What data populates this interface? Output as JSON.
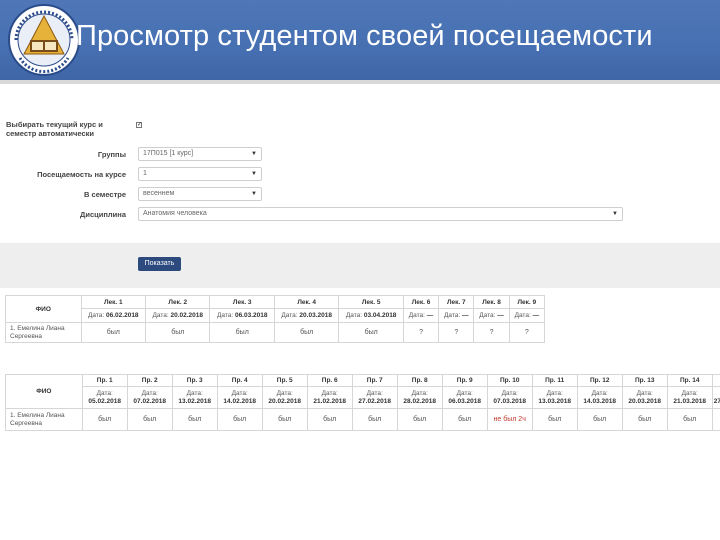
{
  "header": {
    "title": "Просмотр студентом своей посещаемости"
  },
  "form": {
    "auto_label": "Выбирать текущий курс и семестр автоматически",
    "auto_checked": "✓",
    "groups_label": "Группы",
    "groups_value": "17П015 [1 курс]",
    "course_label": "Посещаемость на курсе",
    "course_value": "1",
    "semester_label": "В семестре",
    "semester_value": "весеннем",
    "discipline_label": "Дисциплина",
    "discipline_value": "Анатомия человека",
    "caret": "▼",
    "show_button": "Показать"
  },
  "lectures": {
    "fio_header": "ФИО",
    "columns": [
      {
        "name": "Лек. 1",
        "date_label": "Дата:",
        "date": "06.02.2018",
        "value": "был"
      },
      {
        "name": "Лек. 2",
        "date_label": "Дата:",
        "date": "20.02.2018",
        "value": "был"
      },
      {
        "name": "Лек. 3",
        "date_label": "Дата:",
        "date": "06.03.2018",
        "value": "был"
      },
      {
        "name": "Лек. 4",
        "date_label": "Дата:",
        "date": "20.03.2018",
        "value": "был"
      },
      {
        "name": "Лек. 5",
        "date_label": "Дата:",
        "date": "03.04.2018",
        "value": "был"
      },
      {
        "name": "Лек. 6",
        "date_label": "Дата:",
        "date": "—",
        "value": "?"
      },
      {
        "name": "Лек. 7",
        "date_label": "Дата:",
        "date": "—",
        "value": "?"
      },
      {
        "name": "Лек. 8",
        "date_label": "Дата:",
        "date": "—",
        "value": "?"
      },
      {
        "name": "Лек. 9",
        "date_label": "Дата:",
        "date": "—",
        "value": "?"
      }
    ],
    "student": "1. Емелина Лиана Сергеевна"
  },
  "practicals": {
    "fio_header": "ФИО",
    "columns": [
      {
        "name": "Пр. 1",
        "date_label": "Дата:",
        "date": "05.02.2018",
        "value": "был"
      },
      {
        "name": "Пр. 2",
        "date_label": "Дата:",
        "date": "07.02.2018",
        "value": "был"
      },
      {
        "name": "Пр. 3",
        "date_label": "Дата:",
        "date": "13.02.2018",
        "value": "был"
      },
      {
        "name": "Пр. 4",
        "date_label": "Дата:",
        "date": "14.02.2018",
        "value": "был"
      },
      {
        "name": "Пр. 5",
        "date_label": "Дата:",
        "date": "20.02.2018",
        "value": "был"
      },
      {
        "name": "Пр. 6",
        "date_label": "Дата:",
        "date": "21.02.2018",
        "value": "был"
      },
      {
        "name": "Пр. 7",
        "date_label": "Дата:",
        "date": "27.02.2018",
        "value": "был"
      },
      {
        "name": "Пр. 8",
        "date_label": "Дата:",
        "date": "28.02.2018",
        "value": "был"
      },
      {
        "name": "Пр. 9",
        "date_label": "Дата:",
        "date": "06.03.2018",
        "value": "был"
      },
      {
        "name": "Пр. 10",
        "date_label": "Дата:",
        "date": "07.03.2018",
        "value": "не был 2ч"
      },
      {
        "name": "Пр. 11",
        "date_label": "Дата:",
        "date": "13.03.2018",
        "value": "был"
      },
      {
        "name": "Пр. 12",
        "date_label": "Дата:",
        "date": "14.03.2018",
        "value": "был"
      },
      {
        "name": "Пр. 13",
        "date_label": "Дата:",
        "date": "20.03.2018",
        "value": "был"
      },
      {
        "name": "Пр. 14",
        "date_label": "Дата:",
        "date": "21.03.2018",
        "value": "был"
      },
      {
        "name": "",
        "date_label": "",
        "date": "27",
        "value": ""
      }
    ],
    "student": "1. Емелина Лиана Сергеевна"
  },
  "colors": {
    "banner": "#4670b2",
    "button": "#2c4a7e",
    "absent": "#c0392b"
  }
}
